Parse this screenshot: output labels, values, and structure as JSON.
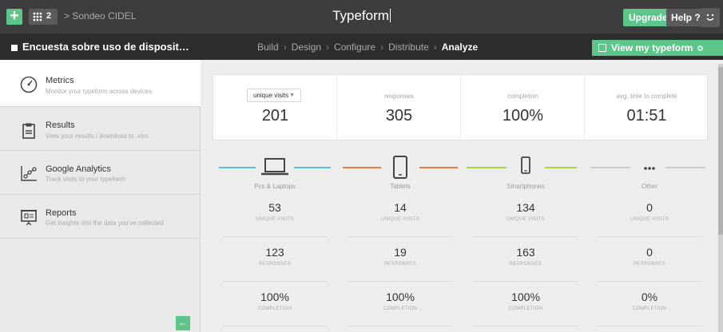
{
  "topbar": {
    "plus": "+",
    "workspace_count": "2",
    "breadcrumb": "> Sondeo CIDEL",
    "brand": "Typeform",
    "upgrade": "Upgrade",
    "help": "Help ?",
    "account_icon": "smiley-icon"
  },
  "docbar": {
    "title": "Encuesta sobre uso de disposit…",
    "steps": [
      "Build",
      "Design",
      "Configure",
      "Distribute",
      "Analyze"
    ],
    "active_step": "Analyze",
    "view_button": "View my typeform"
  },
  "sidebar": {
    "items": [
      {
        "title": "Metrics",
        "desc": "Monitor your typeform across devices",
        "icon": "gauge-icon",
        "active": true
      },
      {
        "title": "Results",
        "desc": "View your results / download to .xlsx",
        "icon": "clipboard-icon",
        "active": false
      },
      {
        "title": "Google Analytics",
        "desc": "Track visits to your typeform",
        "icon": "analytics-icon",
        "active": false
      },
      {
        "title": "Reports",
        "desc": "Get insights into the data you've collected",
        "icon": "presentation-icon",
        "active": false
      }
    ],
    "collapse": "←"
  },
  "stats": {
    "select_value": "unique visits",
    "select_arrow": "▼",
    "unique_visits": "201",
    "responses_label": "responses",
    "responses": "305",
    "completion_label": "completion",
    "completion": "100%",
    "avg_time_label": "avg. time to complete",
    "avg_time": "01:51"
  },
  "devices": [
    {
      "name": "Pcs & Laptops",
      "color": "#5bc3d6",
      "icon": "laptop-icon",
      "visits": "53",
      "responses": "123",
      "completion": "100%"
    },
    {
      "name": "Tablets",
      "color": "#f07b3f",
      "icon": "tablet-icon",
      "visits": "14",
      "responses": "19",
      "completion": "100%"
    },
    {
      "name": "Smartphones",
      "color": "#a9d93a",
      "icon": "smartphone-icon",
      "visits": "134",
      "responses": "163",
      "completion": "100%"
    },
    {
      "name": "Other",
      "color": "#cccccc",
      "icon": "more-icon",
      "visits": "0",
      "responses": "0",
      "completion": "0%"
    }
  ],
  "captions": {
    "visits": "UNIQUE VISITS",
    "responses": "RESPONSES",
    "completion": "COMPLETION"
  }
}
